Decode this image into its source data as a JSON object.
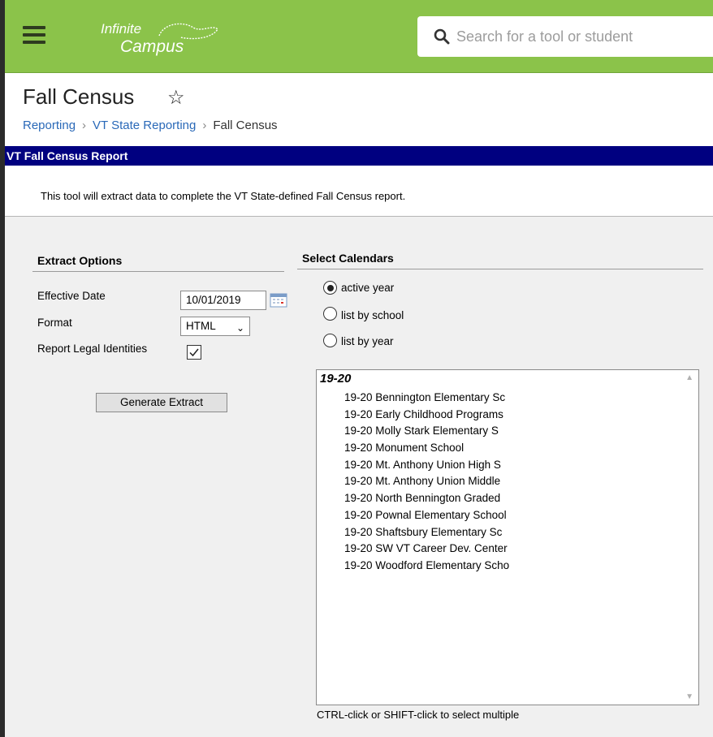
{
  "app": {
    "logo_line1": "Infinite",
    "logo_line2": "Campus",
    "search_placeholder": "Search for a tool or student",
    "brand_color": "#8bc34a"
  },
  "page": {
    "title": "Fall Census",
    "breadcrumb": [
      "Reporting",
      "VT State Reporting",
      "Fall Census"
    ]
  },
  "report": {
    "header": "VT Fall Census Report",
    "description": "This tool will extract data to complete the VT State-defined Fall Census report."
  },
  "extract_options": {
    "header": "Extract Options",
    "effective_date_label": "Effective Date",
    "effective_date_value": "10/01/2019",
    "format_label": "Format",
    "format_value": "HTML",
    "legal_identities_label": "Report Legal Identities",
    "legal_identities_checked": true,
    "generate_button": "Generate Extract"
  },
  "calendars": {
    "header": "Select Calendars",
    "radio_options": [
      "active year",
      "list by school",
      "list by year"
    ],
    "selected_option": "active year",
    "group_label": "19-20",
    "items": [
      "19-20 Bennington Elementary Sc",
      "19-20 Early Childhood Programs",
      "19-20 Molly Stark Elementary S",
      "19-20 Monument School",
      "19-20 Mt. Anthony Union High S",
      "19-20 Mt. Anthony Union Middle",
      "19-20 North Bennington Graded",
      "19-20 Pownal Elementary School",
      "19-20 Shaftsbury Elementary Sc",
      "19-20 SW VT Career Dev. Center",
      "19-20 Woodford Elementary Scho"
    ],
    "hint": "CTRL-click or SHIFT-click to select multiple"
  }
}
